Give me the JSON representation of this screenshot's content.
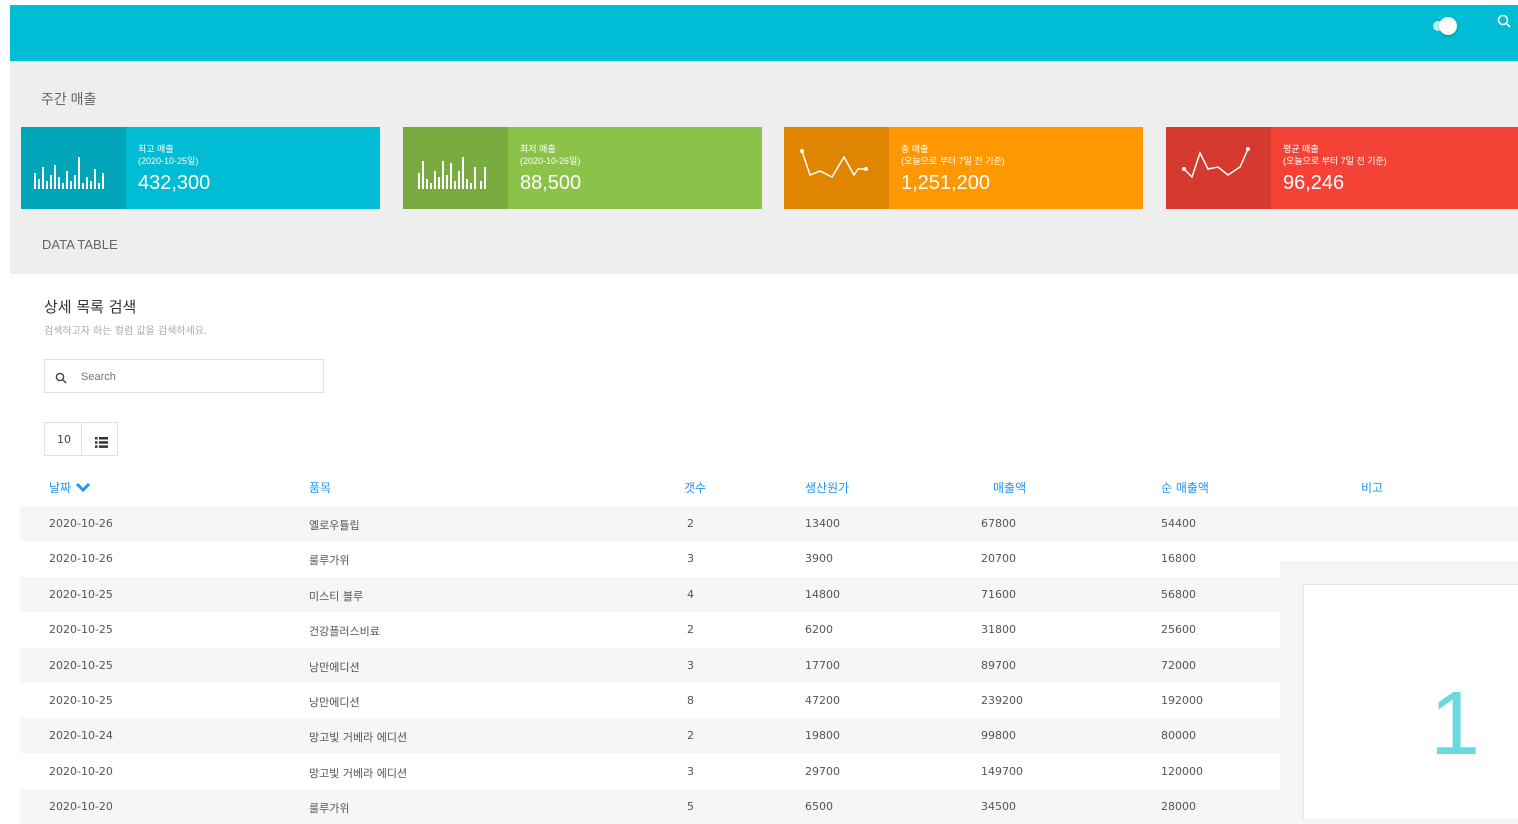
{
  "header": {
    "bg_color": "#00bcd4",
    "toggle_state": "on"
  },
  "weekly": {
    "title": "주간 매출",
    "cards": [
      {
        "label1": "최고 매출",
        "label2": "(2020-10-25일)",
        "value": "432,300",
        "color": "#00bcd4",
        "icon": "bar-chart-icon"
      },
      {
        "label1": "최저 매출",
        "label2": "(2020-10-26일)",
        "value": "88,500",
        "color": "#8bc34a",
        "icon": "bar-chart-icon"
      },
      {
        "label1": "총 매출",
        "label2": "(오늘으로 부터 7일 전 기준)",
        "value": "1,251,200",
        "color": "#ff9800",
        "icon": "line-chart-icon"
      },
      {
        "label1": "평균 매출",
        "label2": "(오늘으로 부터 7일 전 기준)",
        "value": "96,246",
        "color": "#f44336",
        "icon": "line-chart-icon"
      }
    ]
  },
  "data_table": {
    "section_title": "DATA TABLE",
    "panel_title": "상세 목록 검색",
    "panel_subtitle": "검색하고자 하는 컬럼 값을 검색하세요.",
    "search_placeholder": "Search",
    "page_size": "10",
    "columns": [
      "날짜",
      "품목",
      "갯수",
      "생산원가",
      "매출액",
      "순 매출액",
      "비고"
    ],
    "rows": [
      [
        "2020-10-26",
        "옐로우튤립",
        "2",
        "13400",
        "67800",
        "54400",
        ""
      ],
      [
        "2020-10-26",
        "룰루가위",
        "3",
        "3900",
        "20700",
        "16800",
        ""
      ],
      [
        "2020-10-25",
        "미스티 블루",
        "4",
        "14800",
        "71600",
        "56800",
        ""
      ],
      [
        "2020-10-25",
        "건강플러스비료",
        "2",
        "6200",
        "31800",
        "25600",
        ""
      ],
      [
        "2020-10-25",
        "낭만에디션",
        "3",
        "17700",
        "89700",
        "72000",
        ""
      ],
      [
        "2020-10-25",
        "낭만에디션",
        "8",
        "47200",
        "239200",
        "192000",
        ""
      ],
      [
        "2020-10-24",
        "망고빛 거베라 에디션",
        "2",
        "19800",
        "99800",
        "80000",
        ""
      ],
      [
        "2020-10-20",
        "망고빛 거베라 에디션",
        "3",
        "29700",
        "149700",
        "120000",
        ""
      ],
      [
        "2020-10-20",
        "룰루가위",
        "5",
        "6500",
        "34500",
        "28000",
        ""
      ]
    ]
  },
  "overlay": {
    "number": "1"
  }
}
